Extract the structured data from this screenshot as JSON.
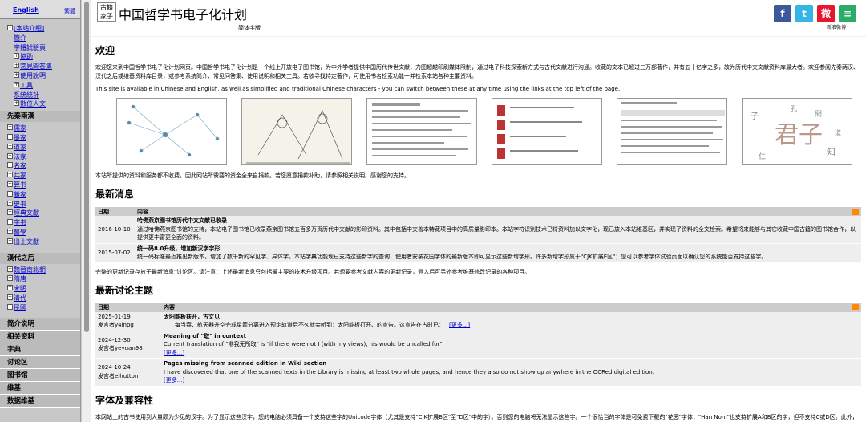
{
  "sidebar": {
    "lang_en": "English",
    "lang_tc": "繁體",
    "intro": [
      {
        "box": "-",
        "label": "[本站介紹]",
        "indent": 0
      },
      {
        "box": "",
        "label": "簡介",
        "indent": 1
      },
      {
        "box": "",
        "label": "字體試驗頁",
        "indent": 1
      },
      {
        "box": "+",
        "label": "協助",
        "indent": 1
      },
      {
        "box": "+",
        "label": "常見問答集",
        "indent": 1
      },
      {
        "box": "+",
        "label": "使用說明",
        "indent": 1
      },
      {
        "box": "+",
        "label": "工具",
        "indent": 1
      },
      {
        "box": "",
        "label": "系統統計",
        "indent": 1
      },
      {
        "box": "+",
        "label": "數位人文",
        "indent": 1
      }
    ],
    "preqin_header": "先秦兩漢",
    "preqin": [
      "儒家",
      "墨家",
      "道家",
      "法家",
      "名家",
      "兵家",
      "算书",
      "雜家",
      "史书",
      "經典文獻",
      "字书",
      "醫學",
      "出土文獻"
    ],
    "han_header": "漢代之后",
    "han": [
      "魏晉南北朝",
      "隋唐",
      "宋明",
      "清代",
      "民國"
    ],
    "bottom": [
      "简介说明",
      "相关资料",
      "字典",
      "讨论区",
      "图书馆",
      "维基",
      "数据维基"
    ]
  },
  "header": {
    "logo_chars": "古籍\n家子",
    "title": "中国哲学书电子化计划",
    "variant": "简体字版",
    "social": [
      {
        "icon": "facebook-icon",
        "char": "f",
        "color": "#3b5998"
      },
      {
        "icon": "twitter-icon",
        "char": "t",
        "color": "#33b5e5"
      },
      {
        "icon": "weibo-icon",
        "char": "微",
        "color": "#e6162d"
      },
      {
        "icon": "wechat-icon",
        "char": "≡",
        "color": "#2aae67"
      }
    ],
    "weibo_caption": "新浪微博"
  },
  "welcome": {
    "heading": "欢迎",
    "para1": "欢迎您来到中国哲学书电子化计划网页。中国哲学书电子化计划是一个线上开放电子图书馆，为中外学者提供中国历代传世文献，力图超越印刷媒体限制，通过电子科技探索新方式与古代文献进行沟通。收藏的文本已超过三万部著作，并有五十亿字之多，故为历代中文文献资料库最大者。欢迎参阅先秦两汉、汉代之后或维基资料库目录，或参考系统简介、常见问答集、使用说明和相关工具。若欲寻找特定著作，可使用书名检索功能一并检索本站各种主要资料。",
    "para2": "This site is available in Chinese and English, as well as simplified and traditional Chinese characters - you can switch between these at any time using the links at the top left of the page.",
    "para3": "本站所提供的资料和服务都不收费。因此网站所需要的资金全来自捐款。若您愿意捐款补助，请参照相关说明。感谢您的支持。"
  },
  "news": {
    "heading": "最新消息",
    "col_date": "日期",
    "col_content": "内容",
    "rows": [
      {
        "date": "2016-10-10",
        "title": "哈佛燕京图书馆历代中文文献已收录",
        "body": "通过哈佛燕京图书馆的支持，本站电子图书馆已收录燕京图书馆五百多万页历代中文献的影印资料。其中包括中文善本特藏项目中的高质量影印本。本站字符识别技术已将资料加以文字化，现已放入本站维基区，并实现了资料的全文检索。希望将来能够与其它收藏中国古籍的图书馆合作，以提供更丰富更全面的资料。"
      },
      {
        "date": "2015-07-02",
        "title": "统一码8.0升级，增加新汉字字形",
        "body": "统一码标准最近推出新版本，增加了数千新的罕见字、异体字。本站字典功能现已支持这些新字的查询，使用者安装花园字体的最新版本即可显示这些新增字形。许多新增字形属于\"CJK扩展E区\"；您可以参考字体试验页面以确认您的系统能否支持这些字。"
      }
    ],
    "footer": "完整的更新记录存放于最新消息\"讨论区。请注意：上述最新消息只包括最主要的技术升级项目。若想要参考文献内容的更新记录，登入后可另外参考维基修改记录的各种项目。"
  },
  "discussion": {
    "heading": "最新讨论主题",
    "col_date": "日期",
    "col_content": "内容",
    "rows": [
      {
        "date": "2025-01-19",
        "poster": "发言者y4inpg",
        "title": "太阳能板扶开，古文见",
        "body": "每当春、航天器升空完成星箭分离进入预定轨道后不久就会听到：太阳能板打开、的宣告。这宣告在古时已：",
        "more": "[更多...]"
      },
      {
        "date": "2024-12-30",
        "poster": "发言者yeyuan98",
        "title": "Meaning of \"取\" in context",
        "body": "Current translation of \"非我无所取\" is \"if there were not I (with my views), his would be uncalled for\".",
        "more": "[更多...]"
      },
      {
        "date": "2024-10-24",
        "poster": "发言者elhutton",
        "title": "Pages missing from scanned edition in Wiki section",
        "body": "I have discovered that one of the scanned texts in the Library is missing at least two whole pages, and hence they also do not show up anywhere in the OCRed digital edition.",
        "more": "[更多...]"
      }
    ]
  },
  "fonts": {
    "heading": "字体及兼容性",
    "para": "本网站上的古书使用到大量颇为少见的汉字。为了显示这些汉字，您的电脑必须具备一个支持这些字的Unicode字体（尤其是支持\"CJK扩展B区\"至\"D区\"中的字）。否则您的电脑将无法显示这些字。一个很恰当的字体是可免费下载的\"花园\"字体；\"Han Nom\"也支持扩展A和B区的字，但不支持C或D区。此外，您的电脑必须支持统一码（Unicode）包括所谓代理字（Surrogates）；这在前些会使得旧的系统软件无法显示这些字。您可以参考字体试验页确定您的电脑目前支持哪些汉字。"
  }
}
